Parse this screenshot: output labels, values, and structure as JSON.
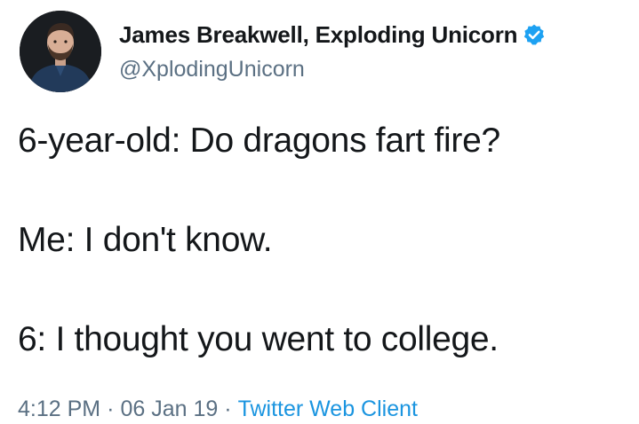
{
  "author": {
    "display_name": "James Breakwell, Exploding Unicorn",
    "handle": "@XplodingUnicorn",
    "verified": true,
    "verified_icon": "verified-badge-icon",
    "avatar_icon": "profile-photo"
  },
  "tweet": {
    "lines": [
      "6-year-old: Do dragons fart fire?",
      "Me: I don't know.",
      "6: I thought you went to college."
    ]
  },
  "meta": {
    "time": "4:12 PM",
    "separator": "·",
    "date": "06 Jan 19",
    "source": "Twitter Web Client"
  },
  "colors": {
    "text": "#14171a",
    "secondary": "#5b7083",
    "link": "#1b95e0",
    "verified": "#1da1f2",
    "background": "#ffffff"
  }
}
